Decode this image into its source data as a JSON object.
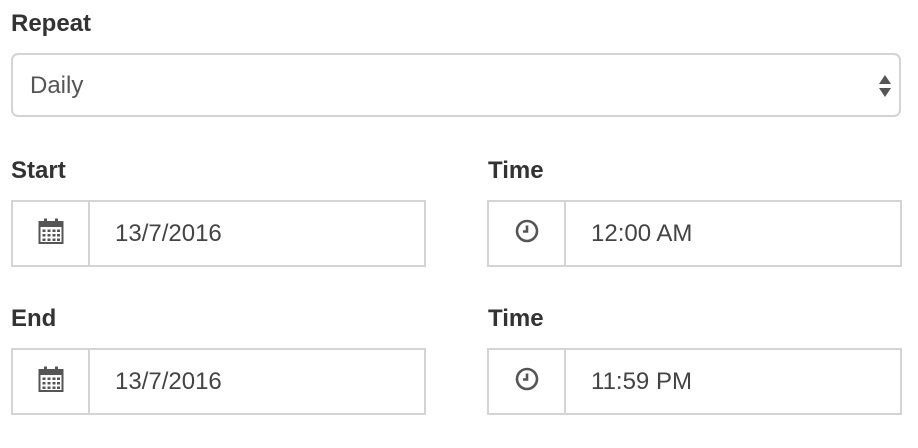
{
  "repeat": {
    "label": "Repeat",
    "selected": "Daily"
  },
  "start": {
    "date_label": "Start",
    "date_value": "13/7/2016",
    "time_label": "Time",
    "time_value": "12:00 AM"
  },
  "end": {
    "date_label": "End",
    "date_value": "13/7/2016",
    "time_label": "Time",
    "time_value": "11:59 PM"
  },
  "icons": {
    "date": "calendar-icon",
    "time": "clock-icon",
    "select": "sort-arrows-icon"
  },
  "colors": {
    "border": "#d3d3d8",
    "label": "#333333",
    "value": "#444444",
    "icon": "#555555"
  }
}
